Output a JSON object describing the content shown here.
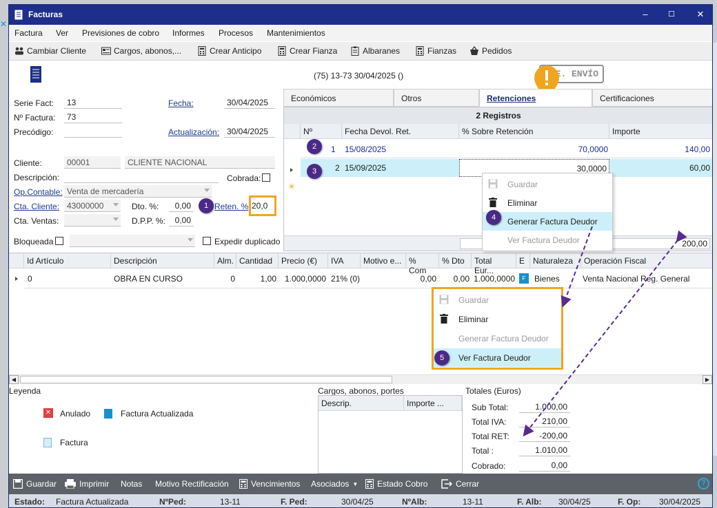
{
  "window": {
    "title": "Facturas",
    "minimize": "–",
    "maximize": "☐",
    "close": "✕"
  },
  "menu": [
    "Factura",
    "Ver",
    "Previsiones de cobro",
    "Informes",
    "Procesos",
    "Mantenimientos"
  ],
  "toolbar": [
    "Cambiar Cliente",
    "Cargos, abonos,...",
    "Crear Anticipo",
    "Crear Fianza",
    "Albaranes",
    "Fianzas",
    "Pedidos"
  ],
  "invoice_caption": "(75) 13-73  30/04/2025  ()",
  "stamp": "PTE. ENVÍO",
  "form": {
    "serie_label": "Serie Fact:",
    "serie_value": "13",
    "numero_label": "Nº Factura:",
    "numero_value": "73",
    "precodigo_label": "Precódigo:",
    "fecha_label": "Fecha:",
    "fecha_value": "30/04/2025",
    "actualizacion_label": "Actualización:",
    "actualizacion_value": "30/04/2025",
    "cliente_label": "Cliente:",
    "cliente_code": "00001",
    "cliente_name": "CLIENTE NACIONAL",
    "descripcion_label": "Descripción:",
    "cobrada_label": "Cobrada:",
    "opcontable_label": "Op.Contable:",
    "opcontable_value": "Venta de mercadería",
    "ctacliente_label": "Cta. Cliente:",
    "ctacliente_value": "43000000",
    "dto_label": "Dto. %:",
    "dto_value": "0,00",
    "reten_label": "Reten. %",
    "reten_value": "20,0",
    "ctaventas_label": "Cta. Ventas:",
    "dpp_label": "D.P.P. %:",
    "dpp_value": "0,00",
    "bloqueada_label": "Bloqueada",
    "expedir_label": "Expedir duplicado"
  },
  "tabs": [
    "Económicos",
    "Otros",
    "Retenciones",
    "Certificaciones"
  ],
  "retenciones": {
    "registros": "2 Registros",
    "headers": [
      "Nº",
      "Fecha Devol. Ret.",
      "% Sobre Retención",
      "Importe"
    ],
    "rows": [
      {
        "n": "1",
        "fecha": "15/08/2025",
        "pct": "70,0000",
        "importe": "140,00"
      },
      {
        "n": "2",
        "fecha": "15/09/2025",
        "pct": "30,0000",
        "importe": "60,00"
      }
    ],
    "total": "200,00"
  },
  "context_menu_1": [
    "Guardar",
    "Eliminar",
    "Generar Factura Deudor",
    "Ver Factura Deudor"
  ],
  "context_menu_2": [
    "Guardar",
    "Eliminar",
    "Generar Factura Deudor",
    "Ver Factura Deudor"
  ],
  "badges": [
    "1",
    "2",
    "3",
    "4",
    "5"
  ],
  "lines": {
    "headers": [
      "Id Artículo",
      "Descripción",
      "Alm.",
      "Cantidad",
      "Precio (€)",
      "IVA",
      "Motivo e...",
      "% Com",
      "% Dto",
      "Total Eur...",
      "E",
      "Naturaleza",
      "Operación Fiscal"
    ],
    "row": {
      "id": "0",
      "desc": "OBRA EN CURSO",
      "alm": "0",
      "cantidad": "1,00",
      "precio": "1.000,0000",
      "iva": "21% (0)",
      "com": "0,00",
      "dto": "0,00",
      "total": "1.000,0000",
      "e": "F",
      "naturaleza": "Bienes",
      "opfiscal": "Venta Nacional Reg. General"
    }
  },
  "leyenda": {
    "title": "Leyenda",
    "anulado": "Anulado",
    "actualizada": "Factura Actualizada",
    "factura": "Factura"
  },
  "cargos": {
    "title": "Cargos, abonos, portes",
    "col1": "Descrip.",
    "col2": "Importe ..."
  },
  "totales": {
    "title": "Totales (Euros)",
    "items": [
      {
        "label": "Sub Total:",
        "value": "1.000,00"
      },
      {
        "label": "Total IVA:",
        "value": "210,00"
      },
      {
        "label": "Total RET:",
        "value": "-200,00"
      },
      {
        "label": "Total :",
        "value": "1.010,00"
      },
      {
        "label": "Cobrado:",
        "value": "0,00"
      }
    ]
  },
  "bottom": [
    "Guardar",
    "Imprimir",
    "Notas",
    "Motivo Rectificación",
    "Vencimientos",
    "Asociados",
    "Estado Cobro",
    "Cerrar"
  ],
  "status": {
    "estado_label": "Estado:",
    "estado_value": "Factura Actualizada",
    "nped_label": "NºPed:",
    "nped_value": "13-11",
    "fped_label": "F. Ped:",
    "fped_value": "30/04/25",
    "nalb_label": "NºAlb:",
    "nalb_value": "13-11",
    "falb_label": "F. Alb:",
    "falb_value": "30/04/25",
    "fop_label": "F. Op:",
    "fop_value": "30/04/2025"
  },
  "colors": {
    "titlebar": "#1d2f8a",
    "accent_orange": "#f0a520",
    "badge_purple": "#4a2a86",
    "selection": "#cdeffa"
  }
}
